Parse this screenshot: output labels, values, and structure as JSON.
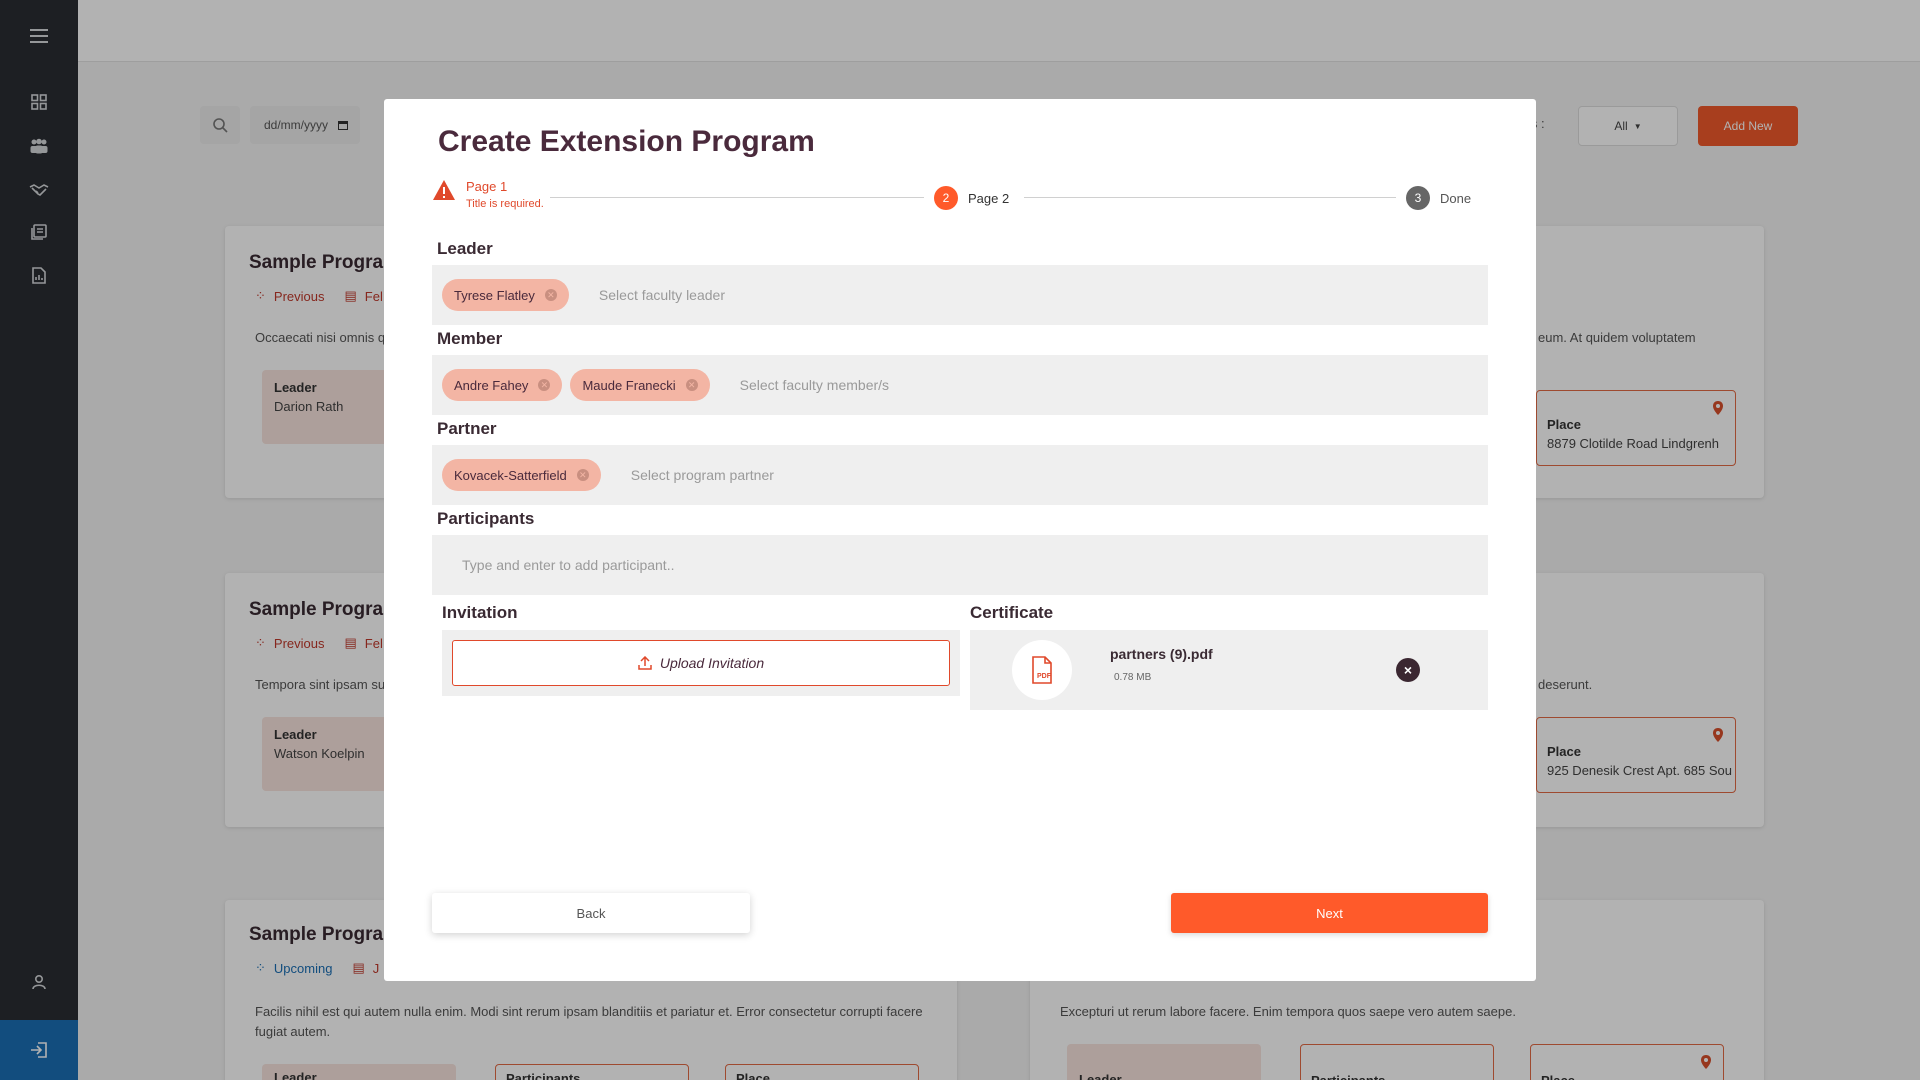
{
  "sidebar": {
    "icons": [
      "menu-icon",
      "dashboard-icon",
      "people-icon",
      "handshake-icon",
      "book-icon",
      "report-icon",
      "user-icon",
      "logout-icon"
    ]
  },
  "toolbar": {
    "date_placeholder": "dd/mm/yyyy",
    "status_label": "tus :",
    "status_value": "All",
    "add_new_label": "Add New"
  },
  "cards": [
    {
      "title": "Sample Progran",
      "status": "Previous",
      "date_frag": "Fel",
      "desc": "Occaecati nisi omnis q",
      "leader_label": "Leader",
      "leader_name": "Darion Rath",
      "right_desc": "eum. At quidem voluptatem",
      "place_label": "Place",
      "place_value": "8879 Clotilde Road Lindgrenh"
    },
    {
      "title": "Sample Progran",
      "status": "Previous",
      "date_frag": "Fel",
      "desc": "Tempora sint ipsam su",
      "leader_label": "Leader",
      "leader_name": "Watson Koelpin",
      "right_desc": "deserunt.",
      "place_label": "Place",
      "place_value": "925 Denesik Crest Apt. 685 Sou"
    },
    {
      "title": "Sample Progran",
      "status": "Upcoming",
      "date_frag": "J",
      "desc": "Facilis nihil est qui autem nulla enim. Modi sint rerum ipsam blanditiis et pariatur et. Error consectetur corrupti facere fugiat autem.",
      "right_desc": "Excepturi ut rerum labore facere. Enim tempora quos saepe vero autem saepe.",
      "leader_label": "Leader",
      "participants_label": "Participants",
      "place_label": "Place"
    }
  ],
  "modal": {
    "title": "Create Extension Program",
    "stepper": {
      "step1_label": "Page 1",
      "step1_error": "Title is required.",
      "step2_number": "2",
      "step2_label": "Page 2",
      "step3_number": "3",
      "step3_label": "Done"
    },
    "leader": {
      "label": "Leader",
      "chips": [
        "Tyrese Flatley"
      ],
      "placeholder": "Select faculty leader"
    },
    "member": {
      "label": "Member",
      "chips": [
        "Andre Fahey",
        "Maude Franecki"
      ],
      "placeholder": "Select faculty member/s"
    },
    "partner": {
      "label": "Partner",
      "chips": [
        "Kovacek-Satterfield"
      ],
      "placeholder": "Select program partner"
    },
    "participants": {
      "label": "Participants",
      "placeholder": "Type and enter to add participant.."
    },
    "invitation": {
      "label": "Invitation",
      "upload_label": "Upload Invitation"
    },
    "certificate": {
      "label": "Certificate",
      "file_name": "partners (9).pdf",
      "file_size": "0.78 MB",
      "file_type": "PDF"
    },
    "back_label": "Back",
    "next_label": "Next"
  },
  "colors": {
    "accent": "#ff5a2a",
    "error": "#e0492b",
    "chip_bg": "#f3b5a4",
    "sidebar": "#2a2d33",
    "title": "#4a2a3c"
  }
}
